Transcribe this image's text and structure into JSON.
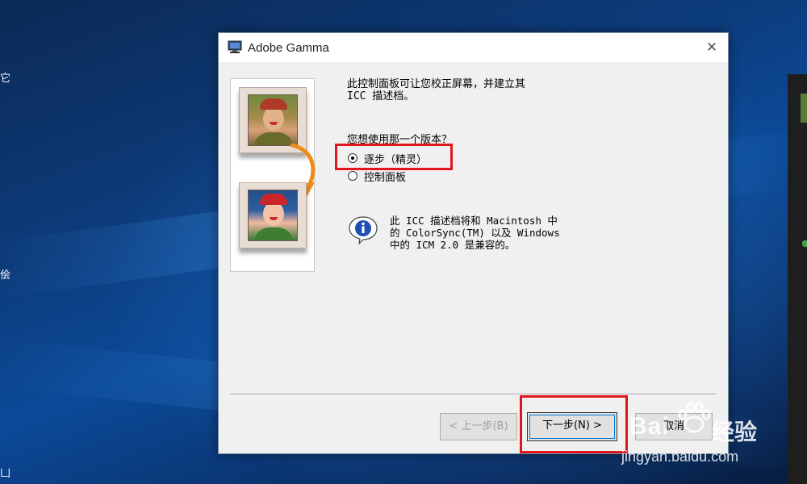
{
  "desktop": {
    "left_glyphs": [
      "它",
      "侩",
      "凵"
    ]
  },
  "dialog": {
    "title": "Adobe Gamma",
    "close_label": "✕",
    "intro_line1": "此控制面板可让您校正屏幕，并建立其",
    "intro_line2": "ICC 描述档。",
    "question": "您想使用那一个版本？",
    "options": [
      {
        "label": "逐步（精灵）",
        "selected": true
      },
      {
        "label": "控制面板",
        "selected": false
      }
    ],
    "info_line1": "此 ICC 描述档将和 Macintosh 中",
    "info_line2": "的 ColorSync(TM) 以及 Windows",
    "info_line3": "中的 ICM 2.0 是兼容的。",
    "buttons": {
      "back": "< 上一步(B)",
      "next": "下一步(N) >",
      "cancel": "取消"
    }
  },
  "watermark": {
    "logo": "Bai",
    "logo_suffix": "经验",
    "url": "jingyan.baidu.com"
  },
  "colors": {
    "highlight": "#e0161e",
    "focus": "#0078d7"
  }
}
